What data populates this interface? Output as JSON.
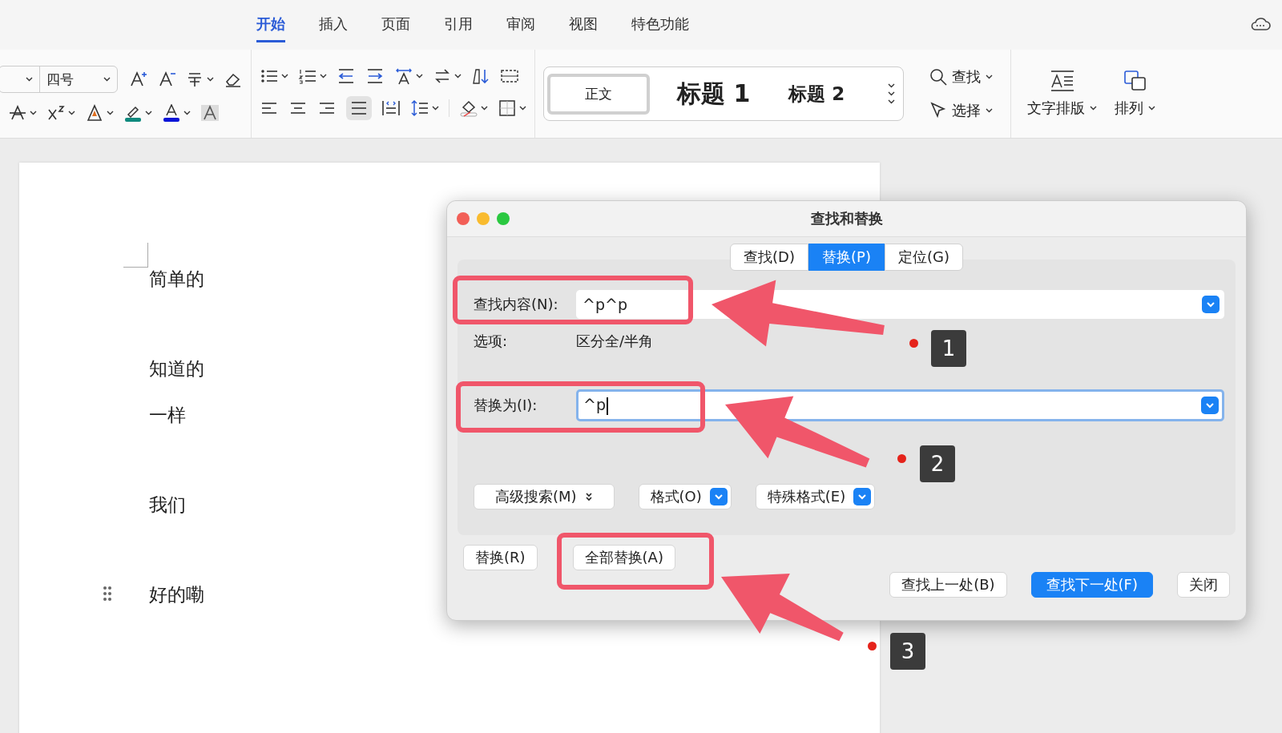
{
  "ribbon_tabs": [
    {
      "label": "开始",
      "selected": true
    },
    {
      "label": "插入",
      "selected": false
    },
    {
      "label": "页面",
      "selected": false
    },
    {
      "label": "引用",
      "selected": false
    },
    {
      "label": "审阅",
      "selected": false
    },
    {
      "label": "视图",
      "selected": false
    },
    {
      "label": "特色功能",
      "selected": false
    }
  ],
  "toolbar": {
    "font_size": "四号",
    "styles": [
      {
        "label": "正文",
        "kind": "body",
        "selected": true
      },
      {
        "label": "标题 1",
        "kind": "h1",
        "selected": false
      },
      {
        "label": "标题 2",
        "kind": "h2",
        "selected": false
      }
    ],
    "find": "查找",
    "select": "选择",
    "text_layout": "文字排版",
    "arrange": "排列"
  },
  "document": {
    "lines": [
      "简单的",
      "知道的",
      "一样",
      "我们",
      "好的嘞"
    ]
  },
  "dialog": {
    "title": "查找和替换",
    "tabs": [
      {
        "label": "查找(D)",
        "selected": false
      },
      {
        "label": "替换(P)",
        "selected": true
      },
      {
        "label": "定位(G)",
        "selected": false
      }
    ],
    "find_label": "查找内容(N):",
    "find_value": "^p^p",
    "options_label": "选项:",
    "options_value": "区分全/半角",
    "replace_label": "替换为(I):",
    "replace_value": "^p",
    "option_buttons": [
      {
        "label": "高级搜索(M)",
        "kind": "expand"
      },
      {
        "label": "格式(O)",
        "kind": "dropdown"
      },
      {
        "label": "特殊格式(E)",
        "kind": "dropdown"
      }
    ],
    "left_buttons": [
      "替换(R)",
      "全部替换(A)"
    ],
    "right_buttons": [
      {
        "label": "查找上一处(B)",
        "primary": false
      },
      {
        "label": "查找下一处(F)",
        "primary": true
      },
      {
        "label": "关闭",
        "primary": false
      }
    ]
  },
  "annotations": [
    {
      "number": "1"
    },
    {
      "number": "2"
    },
    {
      "number": "3"
    }
  ]
}
